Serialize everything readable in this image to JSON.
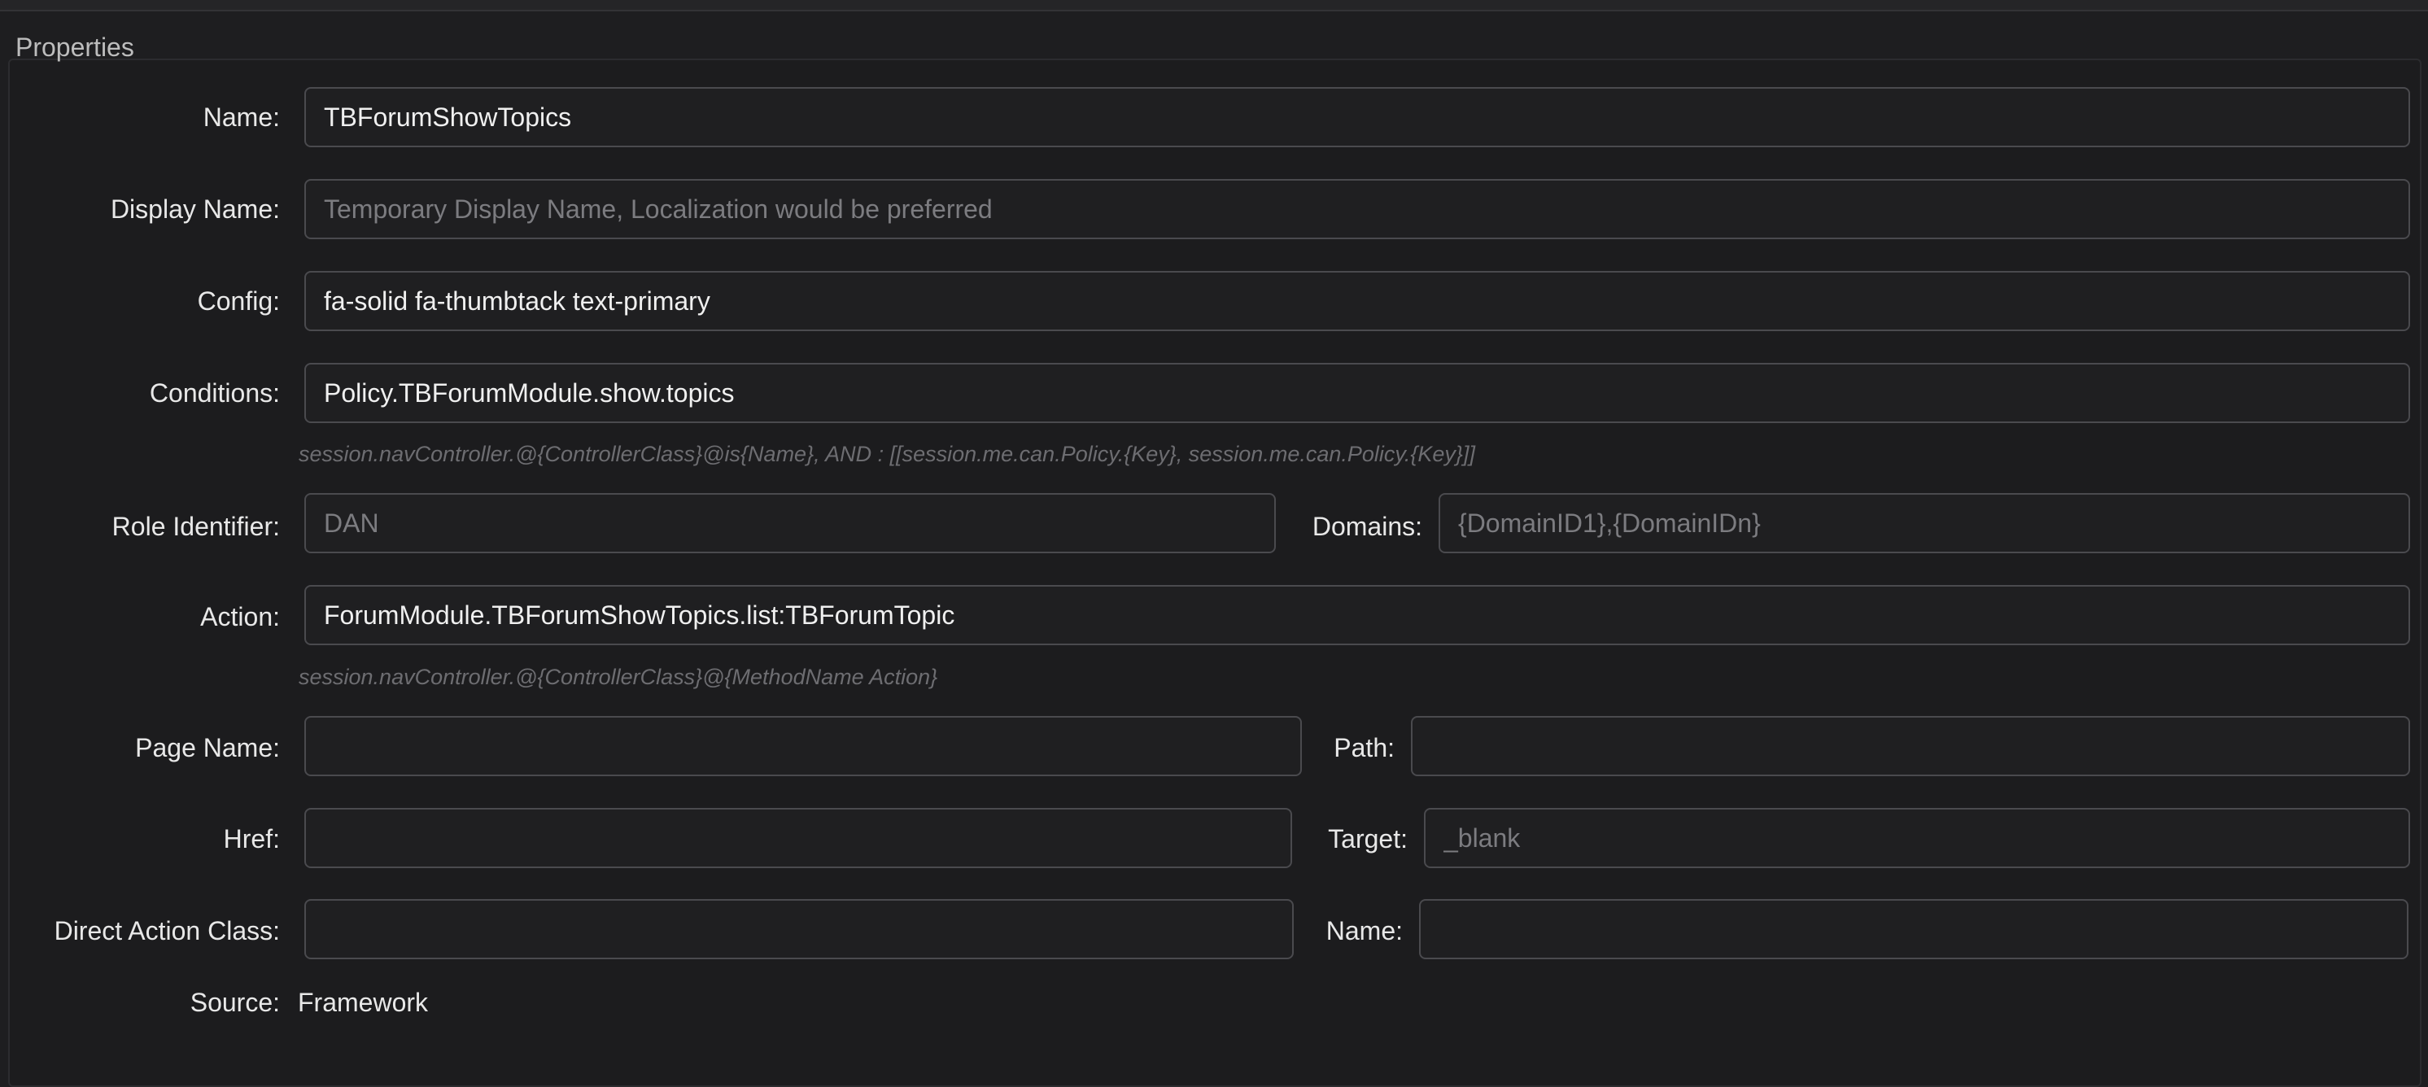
{
  "group": {
    "title": "Properties"
  },
  "fields": {
    "name": {
      "label": "Name:",
      "value": "TBForumShowTopics",
      "placeholder": ""
    },
    "display_name": {
      "label": "Display Name:",
      "value": "",
      "placeholder": "Temporary Display Name, Localization would be preferred"
    },
    "config": {
      "label": "Config:",
      "value": "fa-solid fa-thumbtack text-primary",
      "placeholder": ""
    },
    "conditions": {
      "label": "Conditions:",
      "value": "Policy.TBForumModule.show.topics",
      "placeholder": "",
      "hint": "session.navController.@{ControllerClass}@is{Name}, AND : [[session.me.can.Policy.{Key}, session.me.can.Policy.{Key}]]"
    },
    "role_identifier": {
      "label": "Role Identifier:",
      "value": "",
      "placeholder": "DAN"
    },
    "domains": {
      "label": "Domains:",
      "value": "",
      "placeholder": "{DomainID1},{DomainIDn}"
    },
    "action": {
      "label": "Action:",
      "value": "ForumModule.TBForumShowTopics.list:TBForumTopic",
      "placeholder": "",
      "hint": "session.navController.@{ControllerClass}@{MethodName Action}"
    },
    "page_name": {
      "label": "Page Name:",
      "value": "",
      "placeholder": ""
    },
    "path": {
      "label": "Path:",
      "value": "",
      "placeholder": ""
    },
    "href": {
      "label": "Href:",
      "value": "",
      "placeholder": ""
    },
    "target": {
      "label": "Target:",
      "value": "",
      "placeholder": "_blank"
    },
    "direct_action_class": {
      "label": "Direct Action Class:",
      "value": "",
      "placeholder": ""
    },
    "da_name": {
      "label": "Name:",
      "value": "",
      "placeholder": ""
    },
    "source": {
      "label": "Source:",
      "value": "Framework"
    }
  }
}
